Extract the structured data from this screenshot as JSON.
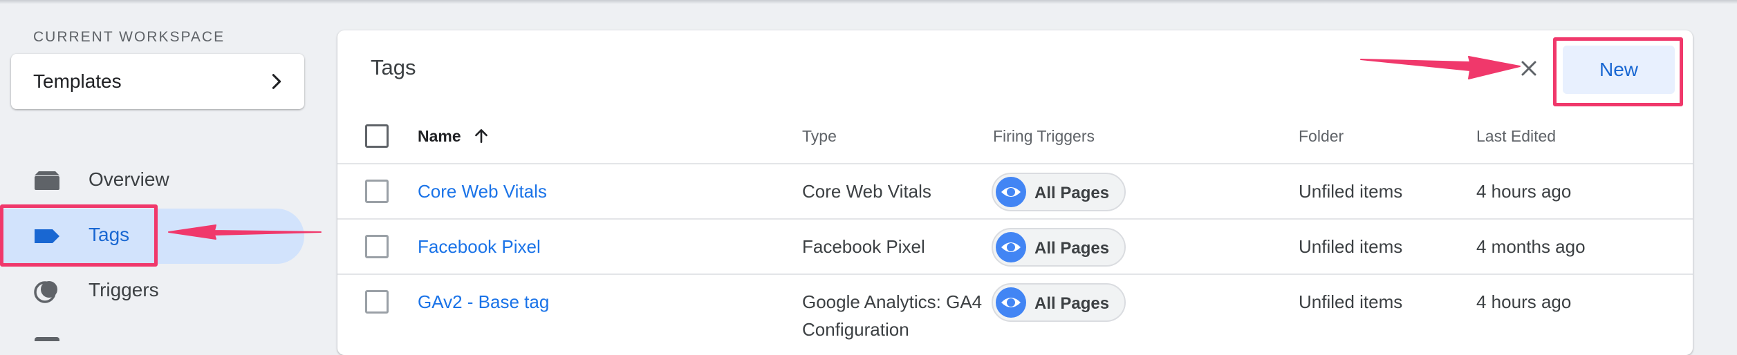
{
  "workspace": {
    "section_label": "CURRENT WORKSPACE",
    "name": "Templates"
  },
  "sidebar": {
    "items": [
      {
        "label": "Overview",
        "icon": "folder-icon"
      },
      {
        "label": "Tags",
        "icon": "tag-icon",
        "active": true
      },
      {
        "label": "Triggers",
        "icon": "triggers-icon"
      }
    ]
  },
  "tags_panel": {
    "title": "Tags",
    "new_button_label": "New",
    "columns": [
      "Name",
      "Type",
      "Firing Triggers",
      "Folder",
      "Last Edited"
    ],
    "rows": [
      {
        "name": "Core Web Vitals",
        "type": "Core Web Vitals",
        "trigger": "All Pages",
        "folder": "Unfiled items",
        "edited": "4 hours ago"
      },
      {
        "name": "Facebook Pixel",
        "type": "Facebook Pixel",
        "trigger": "All Pages",
        "folder": "Unfiled items",
        "edited": "4 months ago"
      },
      {
        "name": "GAv2 - Base tag",
        "type_line1": "Google Analytics: GA4",
        "type_line2": "Configuration",
        "trigger": "All Pages",
        "folder": "Unfiled items",
        "edited": "4 hours ago"
      }
    ]
  },
  "colors": {
    "accent": "#1967d2",
    "annotation": "#f0386b",
    "active_nav_bg": "#d2e3fc"
  }
}
